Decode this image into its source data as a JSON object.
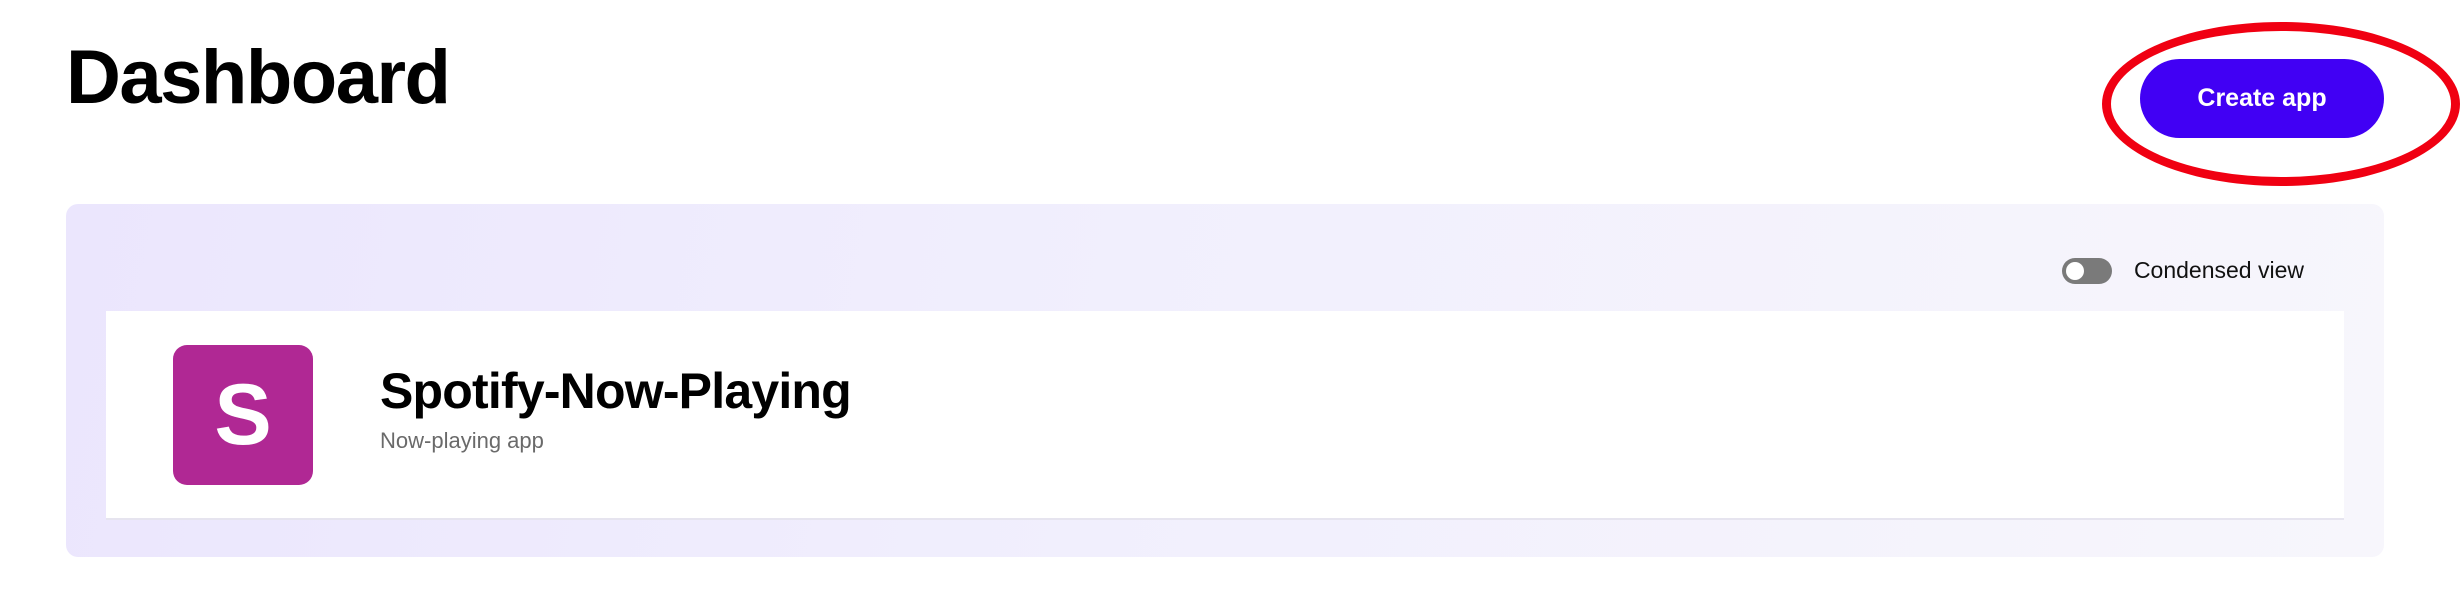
{
  "page": {
    "title": "Dashboard"
  },
  "header": {
    "create_app_label": "Create app"
  },
  "panel": {
    "condensed_view_label": "Condensed view",
    "condensed_view_enabled": false,
    "apps": [
      {
        "avatar_letter": "S",
        "avatar_color": "#b02894",
        "name": "Spotify-Now-Playing",
        "description": "Now-playing app"
      }
    ]
  },
  "colors": {
    "accent": "#4100f4",
    "annotation": "#f00012"
  }
}
